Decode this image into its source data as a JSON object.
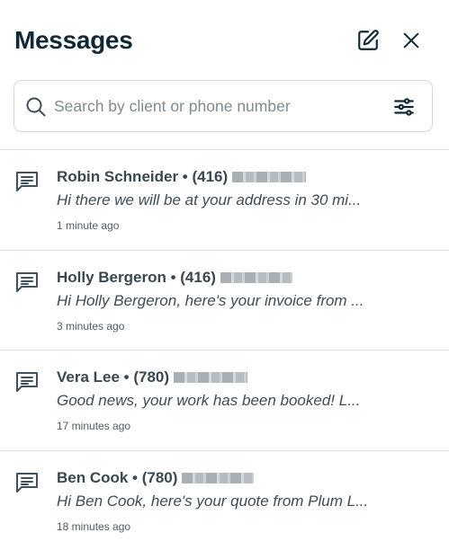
{
  "header": {
    "title": "Messages"
  },
  "icons": {
    "compose": "compose-icon",
    "close": "close-icon",
    "search": "search-icon",
    "filter": "sliders-icon",
    "message": "message-icon"
  },
  "search": {
    "placeholder": "Search by client or phone number",
    "value": ""
  },
  "messages": [
    {
      "title": "Robin Schneider • (416)",
      "preview": "Hi there we will be at your address in 30 mi...",
      "time": "1 minute ago"
    },
    {
      "title": "Holly Bergeron • (416)",
      "preview": "Hi Holly Bergeron, here's your invoice from ...",
      "time": "3 minutes ago"
    },
    {
      "title": "Vera Lee • (780)",
      "preview": "Good news, your work has been booked!  L...",
      "time": "17 minutes ago"
    },
    {
      "title": "Ben Cook • (780)",
      "preview": "Hi Ben Cook, here's your quote from Plum L...",
      "time": "18 minutes ago"
    }
  ],
  "colors": {
    "title": "#0f2a35",
    "text": "#3a4750",
    "border": "#dfe3e6",
    "icon": "#41505a"
  }
}
